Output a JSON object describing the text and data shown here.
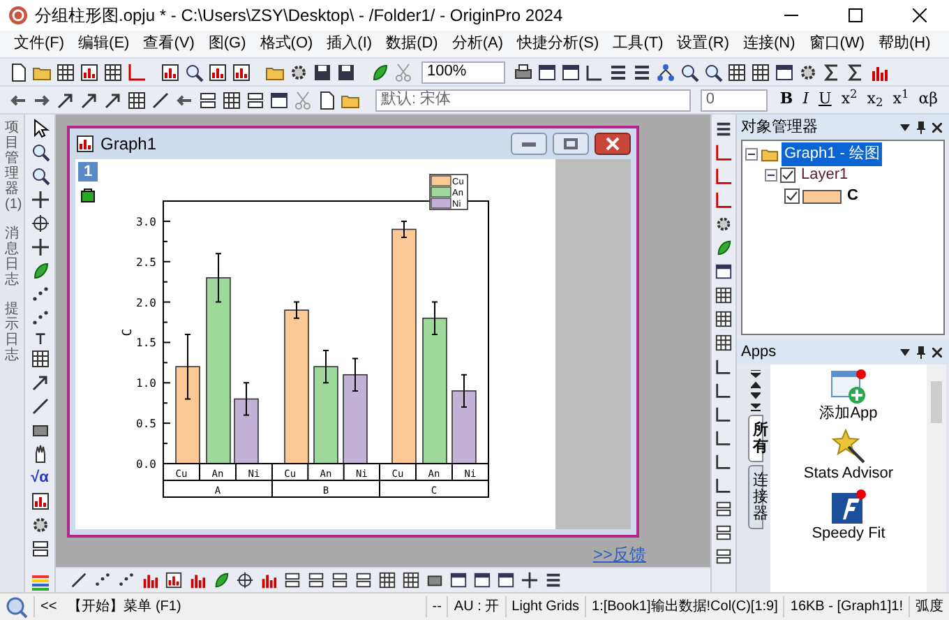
{
  "window": {
    "title": "分组柱形图.opju * - C:\\Users\\ZSY\\Desktop\\ - /Folder1/ - OriginPro 2024"
  },
  "menu": [
    "文件(F)",
    "编辑(E)",
    "查看(V)",
    "图(G)",
    "格式(O)",
    "插入(I)",
    "数据(D)",
    "分析(A)",
    "快捷分析(S)",
    "工具(T)",
    "设置(R)",
    "连接(N)",
    "窗口(W)",
    "帮助(H)"
  ],
  "toolbar": {
    "zoom": "100%",
    "font": "默认: 宋体",
    "font_size": "0",
    "format_buttons": [
      "B",
      "I",
      "U",
      "x$^{2}$",
      "x$_{2}$",
      "x$^{1}$",
      "αβ"
    ]
  },
  "side_tabs": [
    {
      "label": "项目管理器 (1)"
    },
    {
      "label": "消息日志"
    },
    {
      "label": "提示日志"
    }
  ],
  "tools": {
    "math": "√α"
  },
  "graph_window": {
    "title": "Graph1",
    "layer": "1",
    "chart_data": {
      "type": "bar",
      "ylabel": "C",
      "categories": [
        "A",
        "B",
        "C"
      ],
      "annotations": [
        "Cu",
        "An",
        "Ni",
        "Cu",
        "An",
        "Ni",
        "Cu",
        "An",
        "Ni"
      ],
      "legend": true,
      "series": [
        {
          "name": "Cu",
          "color": "#fcc896",
          "values": [
            1.2,
            1.9,
            2.9
          ],
          "errors": [
            0.4,
            0.1,
            0.1
          ]
        },
        {
          "name": "An",
          "color": "#9ed89a",
          "values": [
            2.3,
            1.2,
            1.8
          ],
          "errors": [
            0.3,
            0.2,
            0.2
          ]
        },
        {
          "name": "Ni",
          "color": "#c2b2d8",
          "values": [
            0.8,
            1.1,
            0.9
          ],
          "errors": [
            0.2,
            0.2,
            0.2
          ]
        }
      ],
      "ylim": [
        0,
        3.25
      ],
      "yticks": [
        {
          "value": 0,
          "label": "0.0"
        },
        {
          "value": 0.5,
          "label": "0.5"
        },
        {
          "value": 1,
          "label": "1.0"
        },
        {
          "value": 1.5,
          "label": "1.5"
        },
        {
          "value": 2,
          "label": "2.0"
        },
        {
          "value": 2.5,
          "label": "2.5"
        },
        {
          "value": 3,
          "label": "3.0"
        }
      ]
    }
  },
  "feedback_link": ">>反馈",
  "object_manager": {
    "title": "对象管理器",
    "tree": [
      {
        "label": "Graph1 - 绘图",
        "selected": true,
        "expanded": true,
        "children": [
          {
            "label": "Layer1",
            "selected": false,
            "expanded": true,
            "checked": true,
            "children": [
              {
                "label": "C",
                "selected": false,
                "checked": true,
                "color": "#fcc896"
              }
            ]
          }
        ]
      }
    ]
  },
  "apps": {
    "title": "Apps",
    "tabs": [
      {
        "label": "所有",
        "selected": true
      },
      {
        "label": "连接器",
        "selected": false
      }
    ],
    "items": [
      {
        "label": "添加App"
      },
      {
        "label": "Stats Advisor"
      },
      {
        "label": "Speedy Fit"
      }
    ]
  },
  "status_bar": [
    "<<",
    "【开始】菜单 (F1)",
    "--",
    "AU : 开",
    "Light Grids",
    "1:[Book1]输出数据!Col(C)[1:9]",
    "16KB - [Graph1]1!",
    "弧度"
  ]
}
